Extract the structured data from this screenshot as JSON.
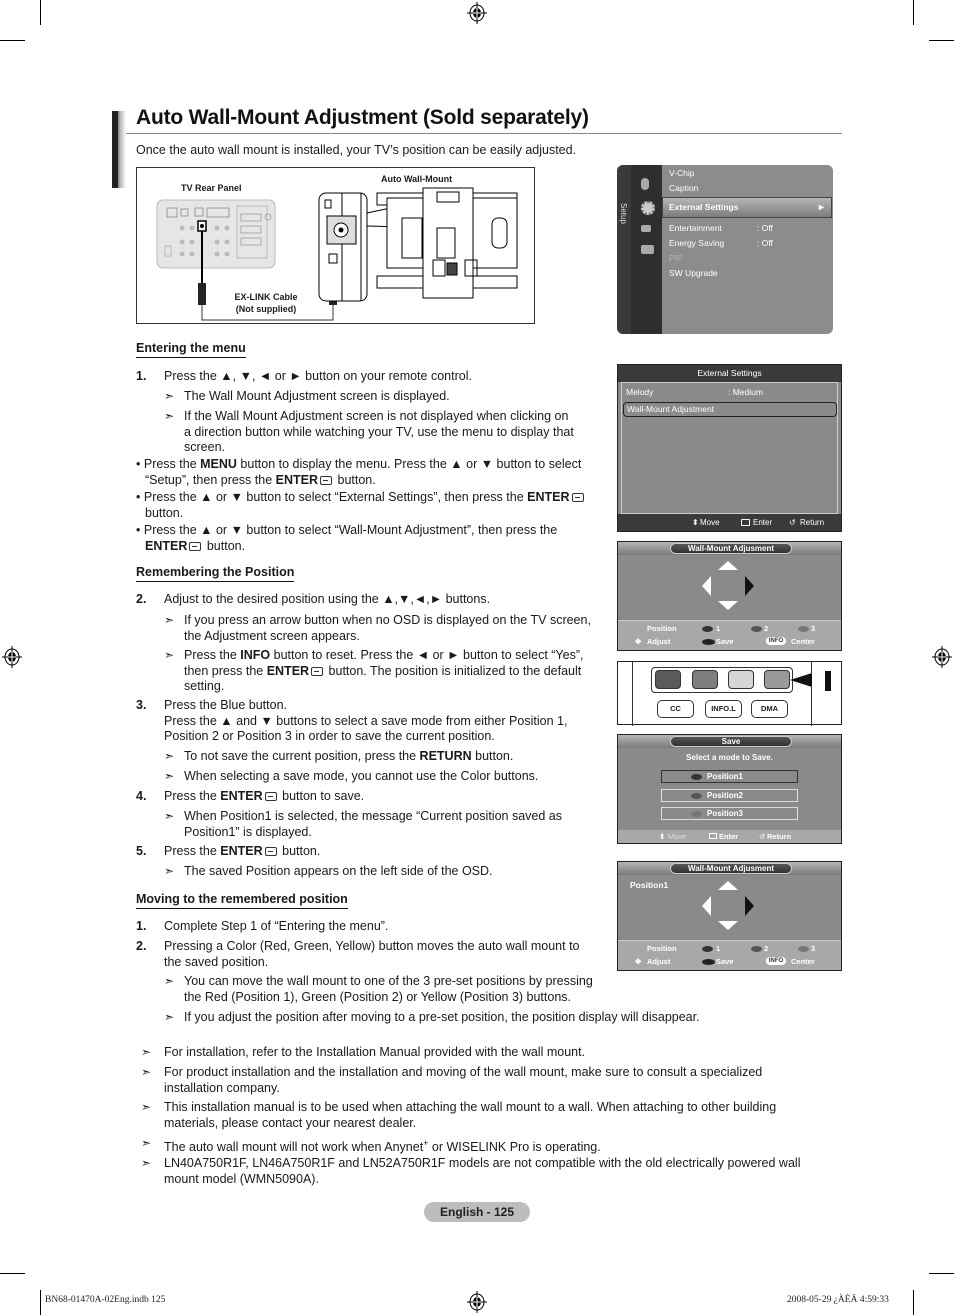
{
  "title": "Auto Wall-Mount Adjustment (Sold separately)",
  "intro": "Once the auto wall mount is installed, your TV’s position can be easily adjusted.",
  "diagram": {
    "tv_rear_panel": "TV Rear Panel",
    "auto_wall_mount": "Auto Wall-Mount",
    "cable_line1": "EX-LINK Cable",
    "cable_line2": "(Not supplied)"
  },
  "sections": {
    "entering": {
      "heading": "Entering the menu",
      "step1_num": "1.",
      "step1": "Press the ▲, ▼, ◄ or ► button on your remote control.",
      "note1": "The Wall Mount Adjustment screen is displayed.",
      "note2_l1": "If the Wall Mount Adjustment screen is not displayed when clicking on",
      "note2_l2": "a direction button while watching your TV, use the menu to display that",
      "note2_l3": "screen.",
      "bullet1_a": "Press the ",
      "bullet1_b": "MENU",
      "bullet1_c": " button to display the menu. Press the ▲ or ▼ button to select",
      "bullet1_d": "“Setup”, then press the ",
      "bullet1_e": "ENTER",
      "bullet1_f": " button.",
      "bullet2_a": "Press the ▲ or ▼ button to select “External Settings”, then press the ",
      "bullet2_b": "ENTER",
      "bullet2_c": "button.",
      "bullet3_a": "Press the ▲ or ▼ button to select “Wall-Mount Adjustment”, then press the",
      "bullet3_b": "ENTER",
      "bullet3_c": " button."
    },
    "remembering": {
      "heading": "Remembering the Position",
      "step2_num": "2.",
      "step2": "Adjust to the desired position using the ▲,▼,◄,► buttons.",
      "note1_l1": "If you press an arrow button when no OSD is displayed on the TV screen,",
      "note1_l2": "the Adjustment screen appears.",
      "note2_a": "Press the ",
      "note2_b": "INFO",
      "note2_c": " button to reset. Press the ◄ or ► button to select “Yes”,",
      "note2_d": "then press the ",
      "note2_e": "ENTER",
      "note2_f": " button. The position is initialized to the default",
      "note2_g": "setting.",
      "step3_num": "3.",
      "step3_l1": "Press the Blue button.",
      "step3_l2": "Press the ▲ and ▼ buttons to select a save mode from either Position 1,",
      "step3_l3": "Position 2 or Position 3 in order to save the current position.",
      "note3_a": "To not save the current position, press the ",
      "note3_b": "RETURN",
      "note3_c": " button.",
      "note4": "When selecting a save mode, you cannot use the Color buttons.",
      "step4_num": "4.",
      "step4_a": "Press the ",
      "step4_b": "ENTER",
      "step4_c": " button to save.",
      "note5_l1": "When Position1 is selected, the message “Current position saved as",
      "note5_l2": "Position1” is displayed.",
      "step5_num": "5.",
      "step5_a": "Press the ",
      "step5_b": "ENTER",
      "step5_c": " button.",
      "note6": "The saved Position appears on the left side of the OSD."
    },
    "moving": {
      "heading": "Moving to the remembered position",
      "step1_num": "1.",
      "step1": "Complete Step 1 of “Entering the menu”.",
      "step2_num": "2.",
      "step2_l1": "Pressing a Color (Red, Green, Yellow) button moves the auto wall mount to",
      "step2_l2": "the saved position.",
      "note1_l1": "You can move the wall mount to one of the 3 pre-set positions by pressing",
      "note1_l2": "the Red (Position 1), Green (Position 2) or Yellow (Position 3) buttons.",
      "note2": "If you adjust the position after moving to a pre-set position, the position display will disappear."
    }
  },
  "general_notes": [
    {
      "l1": "For installation, refer to the Installation Manual provided with the wall mount.",
      "l2": ""
    },
    {
      "l1": "For product installation and the installation and moving of the wall mount, make sure to consult a specialized",
      "l2": "installation company."
    },
    {
      "l1": "This installation manual is to be used when attaching the wall mount to a wall. When attaching to other building",
      "l2": "materials, please contact your nearest dealer."
    },
    {
      "l1": "The auto wall mount will not work when Anynet",
      "sup": "+",
      "l1b": " or WISELINK Pro is operating.",
      "l2": ""
    },
    {
      "l1": "LN40A750R1F, LN46A750R1F and LN52A750R1F models are not compatible with the old electrically powered wall",
      "l2": "mount model (WMN5090A)."
    }
  ],
  "setup_osd": {
    "tab": "Setup",
    "items": [
      {
        "label": "V-Chip",
        "value": ""
      },
      {
        "label": "Caption",
        "value": ""
      },
      {
        "label": "External Settings",
        "value": "►"
      },
      {
        "label": "Entertainment",
        "value": ": Off"
      },
      {
        "label": "Energy Saving",
        "value": ": Off"
      },
      {
        "label": "PIP",
        "value": ""
      },
      {
        "label": "SW Upgrade",
        "value": ""
      }
    ]
  },
  "external_osd": {
    "header": "External Settings",
    "items": [
      {
        "label": "Melody",
        "value": ": Medium"
      },
      {
        "label": "Wall-Mount Adjustment",
        "value": ""
      }
    ],
    "footer": {
      "move": "Move",
      "enter": "Enter",
      "return": "Return"
    }
  },
  "wallmount_osd": {
    "header": "Wall-Mount Adjusment",
    "position_label": "Position",
    "positions": [
      "1",
      "2",
      "3"
    ],
    "adjust": "Adjust",
    "save": "Save",
    "info": "INFO",
    "center": "Center"
  },
  "remote": {
    "buttons": [
      "CC",
      "INFO.L",
      "DMA"
    ],
    "color_buttons": [
      "#5a5a5a",
      "#7e7e7e",
      "#d6d6d6",
      "#9a9a9a"
    ]
  },
  "save_osd": {
    "header": "Save",
    "prompt": "Select a mode to Save.",
    "options": [
      "Position1",
      "Position2",
      "Position3"
    ],
    "footer": {
      "move": "Move",
      "enter": "Enter",
      "return": "Return"
    }
  },
  "wallmount_osd2": {
    "header": "Wall-Mount Adjusment",
    "saved": "Position1",
    "position_label": "Position",
    "positions": [
      "1",
      "2",
      "3"
    ],
    "adjust": "Adjust",
    "save": "Save",
    "info": "INFO",
    "center": "Center"
  },
  "page_label": "English - 125",
  "slug_left": "BN68-01470A-02Eng.indb   125",
  "slug_right": "2008-05-29   ¿ÀÈÄ 4:59:33"
}
